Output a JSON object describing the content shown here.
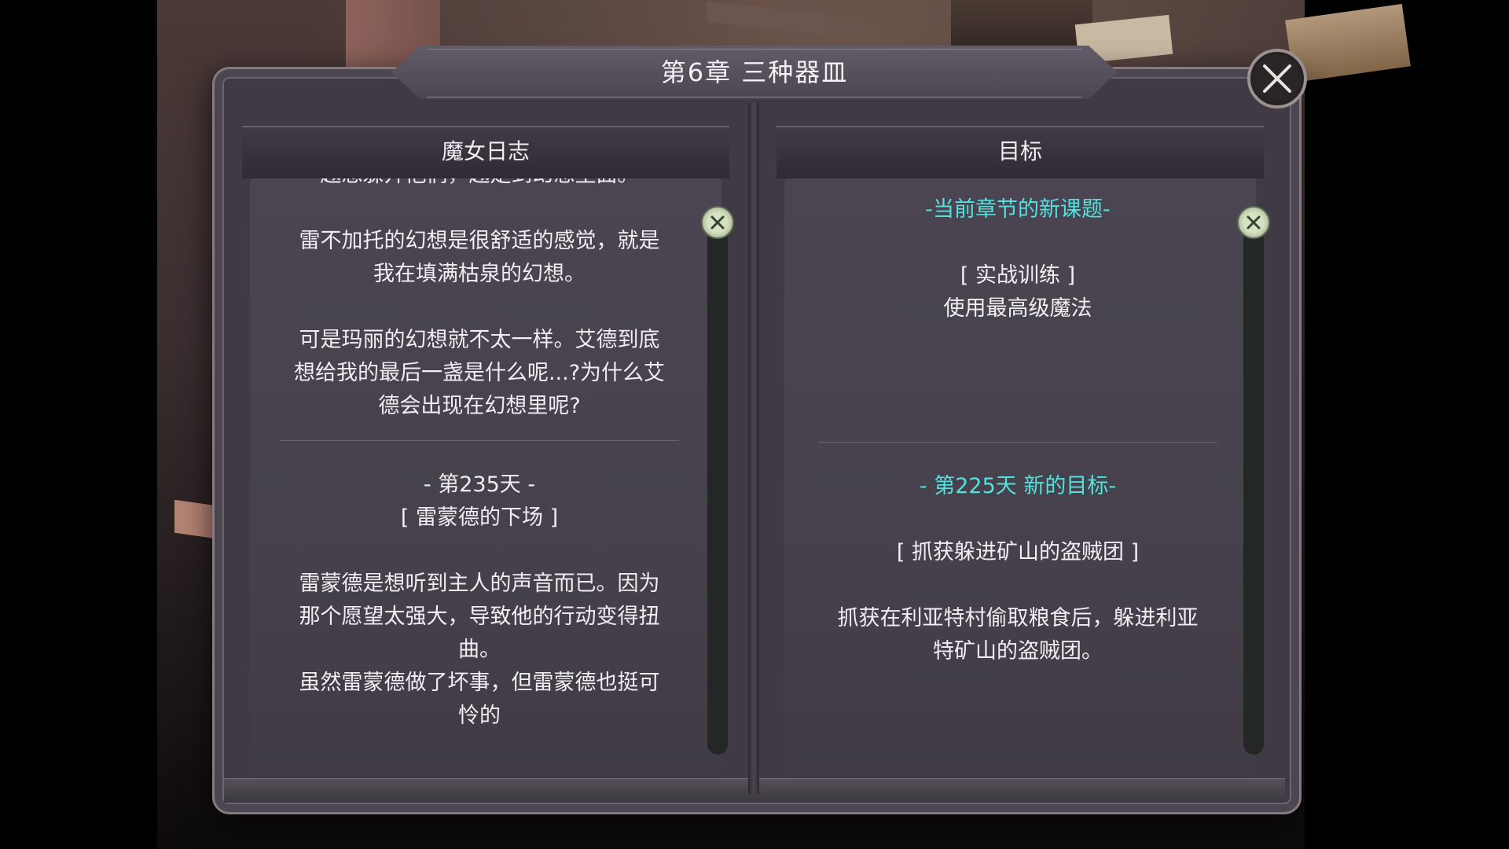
{
  "dialog": {
    "title": "第6章  三种器皿",
    "close_icon": "close-x-icon"
  },
  "left_panel": {
    "header": "魔女日志",
    "cut_top_line": "越想躲开他们，越走到幻想里面。",
    "paragraph_1": [
      "雷不加托的幻想是很舒适的感觉，就是",
      "我在填满枯泉的幻想。"
    ],
    "paragraph_2": [
      "可是玛丽的幻想就不太一样。艾德到底",
      "想给我的最后一盏是什么呢...?为什么艾",
      "德会出现在幻想里呢?"
    ],
    "entry_day": "- 第235天 -",
    "entry_title": "[ 雷蒙德的下场 ]",
    "paragraph_3": [
      "雷蒙德是想听到主人的声音而已。因为",
      "那个愿望太强大，导致他的行动变得扭",
      "曲。"
    ],
    "paragraph_4": [
      "虽然雷蒙德做了坏事，但雷蒙德也挺可",
      "怜的"
    ]
  },
  "right_panel": {
    "header": "目标",
    "current_heading": "-当前章节的新课题-",
    "task_title": "[ 实战训练 ]",
    "task_desc": "使用最高级魔法",
    "goal_heading": "- 第225天  新的目标-",
    "goal_title": "[ 抓获躲进矿山的盗贼团 ]",
    "goal_desc": [
      "抓获在利亚特村偷取粮食后，躲进利亚",
      "特矿山的盗贼团。"
    ]
  },
  "colors": {
    "highlight": "#53e0de",
    "text": "#f1eef2",
    "panel_bg": "#46414c",
    "frame_border": "#857a80"
  }
}
